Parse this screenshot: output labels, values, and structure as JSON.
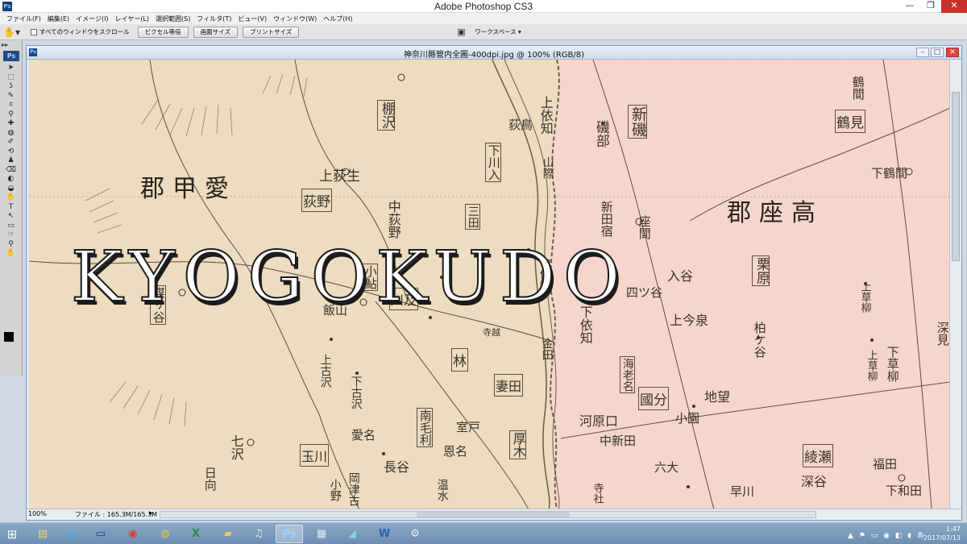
{
  "app": {
    "title": "Adobe Photoshop CS3",
    "icon": "Ps"
  },
  "window_controls": {
    "minimize": "—",
    "maximize": "❐",
    "close": "✕"
  },
  "menu": [
    "ファイル(F)",
    "編集(E)",
    "イメージ(I)",
    "レイヤー(L)",
    "選択範囲(S)",
    "フィルタ(T)",
    "ビュー(V)",
    "ウィンドウ(W)",
    "ヘルプ(H)"
  ],
  "options_bar": {
    "scroll_all_label": "すべてのウィンドウをスクロール",
    "scroll_all_checked": false,
    "buttons": [
      "ピクセル等倍",
      "画面サイズ",
      "プリントサイズ"
    ],
    "workspace_label": "ワークスペース ▾"
  },
  "tools": [
    "➤",
    "⬚",
    "ʖ",
    "✎",
    "⌗",
    "⚲",
    "✚",
    "◍",
    "✐",
    "⟲",
    "♟",
    "⌫",
    "◐",
    "◒",
    "✋",
    "T",
    "↖",
    "▭",
    "☞",
    "⚲",
    "✋"
  ],
  "document": {
    "title": "神奈川縣管内全圖-400dpi.jpg @ 100% (RGB/8)",
    "icon": "Ps",
    "zoom": "100%",
    "file_info": "ファイル : 165.3M/165.3M"
  },
  "map": {
    "colors": {
      "paper": "#ecdcc0",
      "pink": "#f6d6cc",
      "ink": "#3a3128"
    },
    "regions": [
      "郡甲愛",
      "郡座高"
    ],
    "watermark": "KYOGOKUDO",
    "labels": {
      "tanasawa": "棚沢",
      "shimokawairi": "下川入",
      "shinso": "新磯",
      "tsurumi": "鶴見",
      "ogino": "荻野",
      "nakaogino": "中荻野",
      "mimata": "三田",
      "koayu": "小鮎",
      "kawa": "川及",
      "hanbara": "煤ヶ谷",
      "kuribara": "栗原",
      "hayashi": "林",
      "tsuma": "妻田",
      "ebina": "海老名",
      "kokubu": "國分",
      "minamimori": "南毛利",
      "atsugi": "厚木",
      "tamagawa": "玉川",
      "ayase": "綾瀬",
      "kamiogino": "上荻生",
      "kamiyori": "上依知",
      "shimoyori": "下依知",
      "isobe": "磯部",
      "shinden": "新田宿",
      "zama": "座間",
      "iriya": "入谷",
      "yotsuya": "四ツ谷",
      "imaizumi": "上今泉",
      "kasahara": "柏ケ谷",
      "chigasaki": "地望",
      "oyama": "小園",
      "kawara": "河原口",
      "nakashin": "中新田",
      "rokken": "六大",
      "haya": "早川",
      "fukuda": "福田",
      "shimowada": "下和田",
      "fukaya": "深谷",
      "kamikusayanagi": "上草柳",
      "shimokusayanagi": "下草柳",
      "kamikosawa": "上古沢",
      "shimokosawa": "下古沢",
      "aiko": "愛名",
      "nagaya": "長谷",
      "shichisawa": "七沢",
      "hinata": "日向",
      "okatsu": "岡津古",
      "onnu": "恩名",
      "muro": "室戸",
      "kiyosumi": "温水",
      "koyo": "小野",
      "iiyama": "飯山",
      "yamanojima": "山際",
      "nakaori": "中依知",
      "kanada": "金田",
      "mizuho": "寺越",
      "tsuruma": "鶴間",
      "shimotsuruma": "下鶴間",
      "fukasawa": "深見",
      "kamikusa": "上草柳",
      "hosoyama": "寺社",
      "okanai": "荻鳥"
    }
  },
  "taskbar": {
    "start": "⊞",
    "apps": [
      "explorer",
      "ie",
      "screen",
      "app-red",
      "chrome",
      "excel",
      "folder",
      "itunes",
      "photoshop",
      "calculator",
      "notes",
      "word",
      "tools"
    ],
    "app_glyphs": [
      "▤",
      "e",
      "▭",
      "◉",
      "◍",
      "X",
      "▰",
      "♫",
      "Ps",
      "▦",
      "◢",
      "W",
      "⚙"
    ],
    "active_app": "photoshop",
    "tray": "▲ ⚑ ▭ ◉ ◧ ◖ あ",
    "time": "1:47",
    "date": "2017/07/13"
  }
}
